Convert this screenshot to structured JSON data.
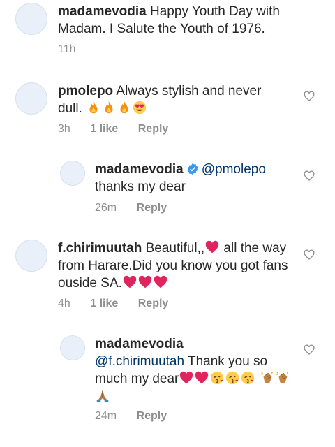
{
  "comments": [
    {
      "username": "madamevodia",
      "text": "Happy Youth Day with Madam. I Salute the Youth of 1976.",
      "time": "11h"
    },
    {
      "username": "pmolepo",
      "text": "Always stylish and never dull.",
      "emoji": [
        "fire",
        "fire",
        "fire",
        "heart-eyes"
      ],
      "time": "3h",
      "likes": "1 like",
      "reply": "Reply"
    },
    {
      "username": "madamevodia",
      "verified": true,
      "mention": "@pmolepo",
      "text": "thanks my dear",
      "time": "26m",
      "reply": "Reply"
    },
    {
      "username": "f.chirimuutah",
      "text_a": "Beautiful,,",
      "text_b": "all the way from Harare.Did you know you got fans ouside SA.",
      "emoji": [
        "red-heart",
        "red-heart",
        "red-heart",
        "red-heart"
      ],
      "time": "4h",
      "likes": "1 like",
      "reply": "Reply"
    },
    {
      "username": "madamevodia",
      "mention": "@f.chirimuutah",
      "text": "Thank you so much my dear",
      "emoji": [
        "red-heart",
        "red-heart",
        "kiss-face",
        "kiss-face",
        "kiss-face",
        "clap",
        "clap",
        "pray"
      ],
      "time": "24m",
      "reply": "Reply"
    }
  ],
  "colors": {
    "text": "#262626",
    "meta": "#8e8e8e",
    "mention": "#00376b",
    "verified": "#3897f0",
    "heart_emoji": "#e0245e"
  }
}
